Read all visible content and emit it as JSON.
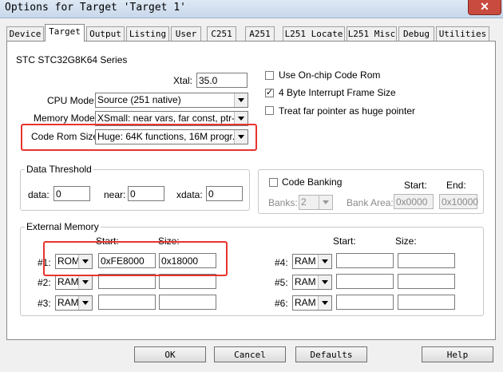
{
  "window": {
    "title": "Options for Target 'Target 1'",
    "close_glyph": "✕"
  },
  "tabs": [
    "Device",
    "Target",
    "Output",
    "Listing",
    "User",
    "C251",
    "A251",
    "L251 Locate",
    "L251 Misc",
    "Debug",
    "Utilities"
  ],
  "series": "STC STC32G8K64 Series",
  "xtal": {
    "label": "Xtal:",
    "value": "35.0"
  },
  "cpu_mode": {
    "label": "CPU Mode:",
    "value": "Source (251 native)"
  },
  "memory_model": {
    "label": "Memory Model:",
    "value": "XSmall: near vars, far const, ptr-4"
  },
  "code_rom_size": {
    "label": "Code Rom Size:",
    "value": "Huge: 64K functions, 16M progr."
  },
  "options": {
    "use_onchip": {
      "label": "Use On-chip Code Rom",
      "checked": false
    },
    "four_byte": {
      "label": "4 Byte Interrupt Frame Size",
      "checked": true
    },
    "treat_far": {
      "label": "Treat far pointer as huge pointer",
      "checked": false
    },
    "check_glyph": "✓"
  },
  "data_threshold": {
    "title": "Data Threshold",
    "data_label": "data:",
    "data_value": "0",
    "near_label": "near:",
    "near_value": "0",
    "xdata_label": "xdata:",
    "xdata_value": "0"
  },
  "code_banking": {
    "label": "Code Banking",
    "start_label": "Start:",
    "end_label": "End:",
    "banks_label": "Banks:",
    "banks_value": "2",
    "bank_area_label": "Bank Area:",
    "start_value": "0x0000",
    "end_value": "0x10000"
  },
  "external_memory": {
    "title": "External Memory",
    "start_label": "Start:",
    "size_label": "Size:",
    "rows_left": [
      {
        "label": "#1:",
        "type": "ROM",
        "start": "0xFE8000",
        "size": "0x18000"
      },
      {
        "label": "#2:",
        "type": "RAM",
        "start": "",
        "size": ""
      },
      {
        "label": "#3:",
        "type": "RAM",
        "start": "",
        "size": ""
      }
    ],
    "rows_right": [
      {
        "label": "#4:",
        "type": "RAM",
        "start": "",
        "size": ""
      },
      {
        "label": "#5:",
        "type": "RAM",
        "start": "",
        "size": ""
      },
      {
        "label": "#6:",
        "type": "RAM",
        "start": "",
        "size": ""
      }
    ]
  },
  "buttons": {
    "ok": "OK",
    "cancel": "Cancel",
    "defaults": "Defaults",
    "help": "Help"
  },
  "colors": {
    "highlight": "#e8332e"
  }
}
